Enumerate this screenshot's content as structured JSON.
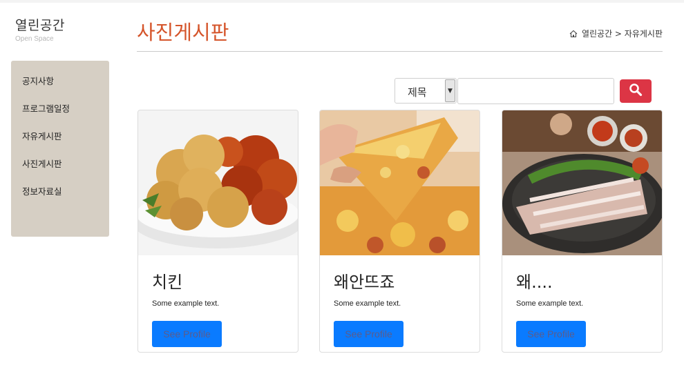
{
  "brand": {
    "title": "열린공간",
    "subtitle": "Open Space"
  },
  "sidebar": {
    "items": [
      {
        "label": "공지사항"
      },
      {
        "label": "프로그램일정"
      },
      {
        "label": "자유게시판"
      },
      {
        "label": "사진게시판"
      },
      {
        "label": "정보자료실"
      }
    ]
  },
  "header": {
    "title": "사진게시판",
    "breadcrumb": "열린공간 > 자유게시판"
  },
  "search": {
    "select_value": "제목",
    "input_value": "",
    "button_icon": "search-icon"
  },
  "cards": [
    {
      "title": "치킨",
      "text": "Some example text.",
      "button": "See Profile",
      "image": "fried-chicken-photo"
    },
    {
      "title": "왜안뜨죠",
      "text": "Some example text.",
      "button": "See Profile",
      "image": "pizza-photo"
    },
    {
      "title": "왜....",
      "text": "Some example text.",
      "button": "See Profile",
      "image": "bossam-pork-photo"
    }
  ],
  "colors": {
    "title": "#d5552b",
    "sidebar_bg": "#d6cfc4",
    "search_button": "#dc3545",
    "card_button": "#0a7bff"
  }
}
